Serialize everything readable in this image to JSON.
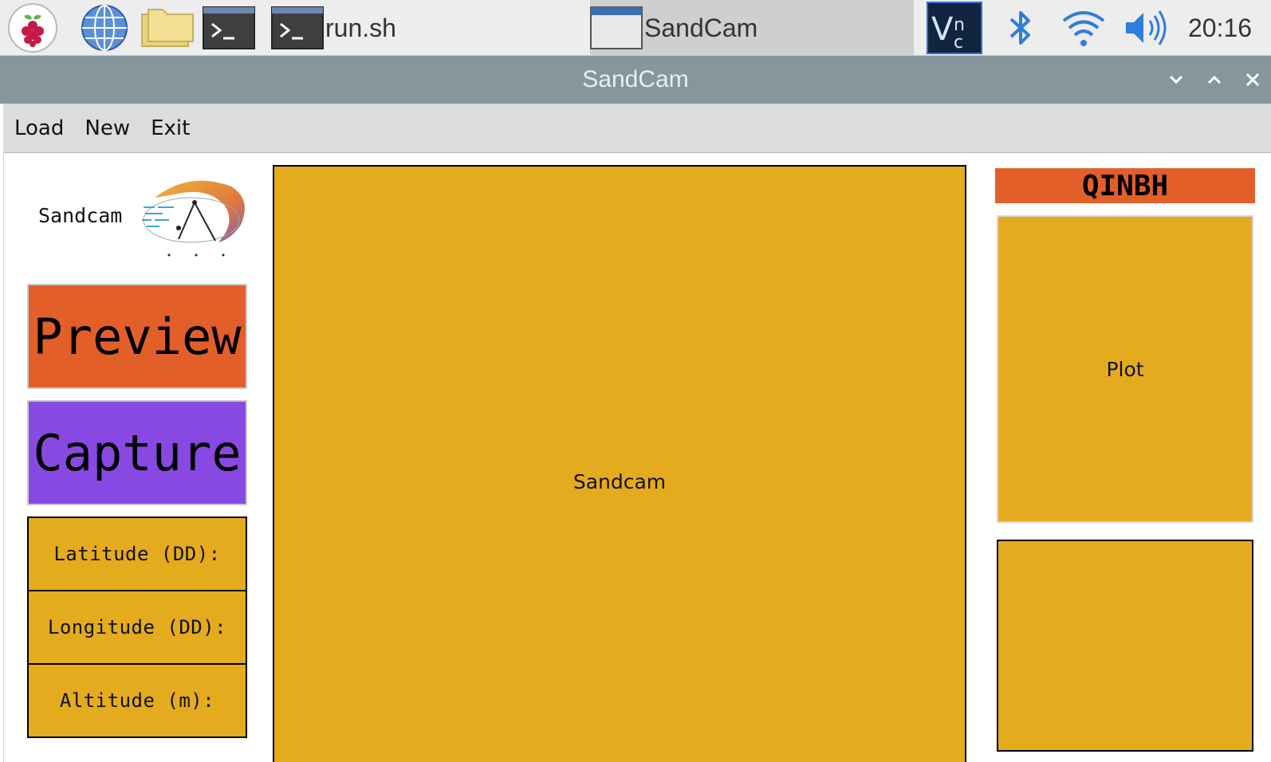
{
  "taskbar": {
    "tasks": [
      {
        "label": "run.sh"
      },
      {
        "label": "SandCam"
      }
    ],
    "clock": "20:16"
  },
  "window": {
    "title": "SandCam"
  },
  "menu": {
    "items": [
      "Load",
      "New",
      "Exit"
    ]
  },
  "sidebar": {
    "logo_text": "Sandcam",
    "preview_label": "Preview",
    "capture_label": "Capture",
    "preview_color": "#e25f2a",
    "capture_color": "#8849e2",
    "fields": [
      {
        "label": "Latitude (DD):"
      },
      {
        "label": "Longitude (DD):"
      },
      {
        "label": "Altitude (m):"
      }
    ]
  },
  "main": {
    "preview_label": "Sandcam",
    "panel_color": "#e5ab1e"
  },
  "right": {
    "station_id": "QINBH",
    "plot_label": "Plot"
  }
}
